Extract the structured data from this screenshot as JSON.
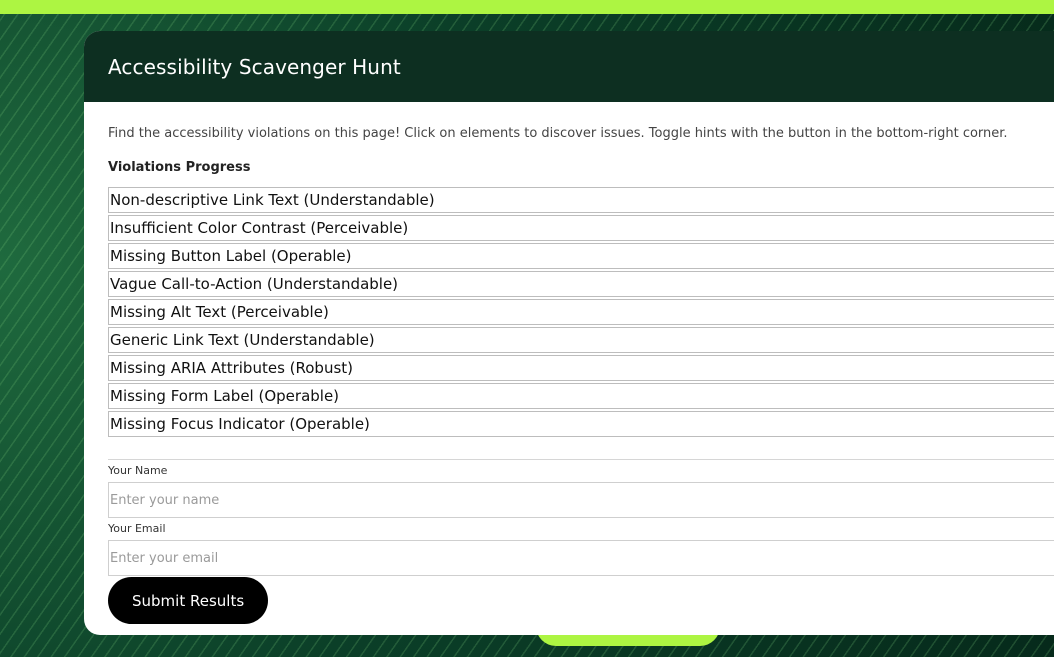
{
  "page": {
    "title": "Accessibility Scavenger Hunt",
    "intro": "Find the accessibility violations on this page! Click on elements to discover issues. Toggle hints with the button in the bottom-right corner.",
    "progress_heading": "Violations Progress"
  },
  "violations": [
    "Non-descriptive Link Text (Understandable)",
    "Insufficient Color Contrast (Perceivable)",
    "Missing Button Label (Operable)",
    "Vague Call-to-Action (Understandable)",
    "Missing Alt Text (Perceivable)",
    "Generic Link Text (Understandable)",
    "Missing ARIA Attributes (Robust)",
    "Missing Form Label (Operable)",
    "Missing Focus Indicator (Operable)"
  ],
  "form": {
    "name_label": "Your Name",
    "name_placeholder": "Enter your name",
    "name_value": "",
    "email_label": "Your Email",
    "email_placeholder": "Enter your email",
    "email_value": "",
    "submit_label": "Submit Results"
  },
  "colors": {
    "accent_lime": "#adf542",
    "header_dark": "#0d2f21",
    "button_black": "#000000"
  }
}
